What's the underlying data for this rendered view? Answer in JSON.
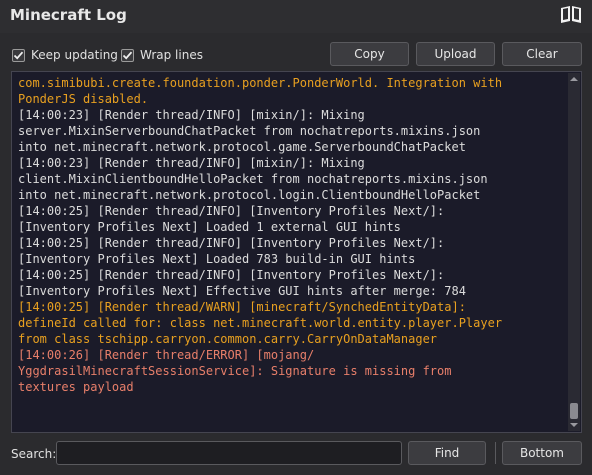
{
  "window": {
    "title": "Minecraft Log",
    "icon": "book-icon"
  },
  "toolbar": {
    "keep_updating": {
      "label": "Keep updating",
      "checked": true
    },
    "wrap_lines": {
      "label": "Wrap lines",
      "checked": true
    },
    "copy_label": "Copy",
    "upload_label": "Upload",
    "clear_label": "Clear"
  },
  "log": {
    "lines": [
      {
        "level": "warn",
        "text": "com.simibubi.create.foundation.ponder.PonderWorld. Integration with PonderJS disabled."
      },
      {
        "level": "info",
        "text": "[14:00:23] [Render thread/INFO] [mixin/]: Mixing server.MixinServerboundChatPacket from nochatreports.mixins.json into net.minecraft.network.protocol.game.ServerboundChatPacket"
      },
      {
        "level": "info",
        "text": "[14:00:23] [Render thread/INFO] [mixin/]: Mixing client.MixinClientboundHelloPacket from nochatreports.mixins.json into net.minecraft.network.protocol.login.ClientboundHelloPacket"
      },
      {
        "level": "info",
        "text": "[14:00:25] [Render thread/INFO] [Inventory Profiles Next/]: [Inventory Profiles Next] Loaded 1 external GUI hints"
      },
      {
        "level": "info",
        "text": "[14:00:25] [Render thread/INFO] [Inventory Profiles Next/]: [Inventory Profiles Next] Loaded 783 build-in GUI hints"
      },
      {
        "level": "info",
        "text": "[14:00:25] [Render thread/INFO] [Inventory Profiles Next/]: [Inventory Profiles Next] Effective GUI hints after merge: 784"
      },
      {
        "level": "warn",
        "text": "[14:00:25] [Render thread/WARN] [minecraft/SynchedEntityData]: defineId called for: class net.minecraft.world.entity.player.Player from class tschipp.carryon.common.carry.CarryOnDataManager"
      },
      {
        "level": "error",
        "text": "[14:00:26] [Render thread/ERROR] [mojang/ YggdrasilMinecraftSessionService]: Signature is missing from textures payload"
      }
    ],
    "display_rows": [
      {
        "level": "warn",
        "text": "com.simibubi.create.foundation.ponder.PonderWorld. Integration with"
      },
      {
        "level": "warn",
        "text": "PonderJS disabled."
      },
      {
        "level": "info",
        "text": "[14:00:23] [Render thread/INFO] [mixin/]: Mixing"
      },
      {
        "level": "info",
        "text": "server.MixinServerboundChatPacket from nochatreports.mixins.json"
      },
      {
        "level": "info",
        "text": "into net.minecraft.network.protocol.game.ServerboundChatPacket"
      },
      {
        "level": "info",
        "text": "[14:00:23] [Render thread/INFO] [mixin/]: Mixing"
      },
      {
        "level": "info",
        "text": "client.MixinClientboundHelloPacket from nochatreports.mixins.json"
      },
      {
        "level": "info",
        "text": "into net.minecraft.network.protocol.login.ClientboundHelloPacket"
      },
      {
        "level": "info",
        "text": "[14:00:25] [Render thread/INFO] [Inventory Profiles Next/]:"
      },
      {
        "level": "info",
        "text": "[Inventory Profiles Next] Loaded 1 external GUI hints"
      },
      {
        "level": "info",
        "text": "[14:00:25] [Render thread/INFO] [Inventory Profiles Next/]:"
      },
      {
        "level": "info",
        "text": "[Inventory Profiles Next] Loaded 783 build-in GUI hints"
      },
      {
        "level": "info",
        "text": "[14:00:25] [Render thread/INFO] [Inventory Profiles Next/]:"
      },
      {
        "level": "info",
        "text": "[Inventory Profiles Next] Effective GUI hints after merge: 784"
      },
      {
        "level": "warn",
        "text": "[14:00:25] [Render thread/WARN] [minecraft/SynchedEntityData]:"
      },
      {
        "level": "warn",
        "text": "defineId called for: class net.minecraft.world.entity.player.Player"
      },
      {
        "level": "warn",
        "text": "from class tschipp.carryon.common.carry.CarryOnDataManager"
      },
      {
        "level": "error",
        "text": "[14:00:26] [Render thread/ERROR] [mojang/"
      },
      {
        "level": "error",
        "text": "YggdrasilMinecraftSessionService]: Signature is missing from"
      },
      {
        "level": "error",
        "text": "textures payload"
      }
    ],
    "scroll_position": 1.0,
    "scroll_visible_fraction": 0.04
  },
  "bottom": {
    "search_label": "Search:",
    "search_value": "",
    "find_label": "Find",
    "bottom_label": "Bottom"
  },
  "colors": {
    "info": "#dcdcdc",
    "warn": "#e8a020",
    "error": "#e87f6a",
    "log_background": "#1b1b29",
    "window_background": "#2b2b2e"
  }
}
